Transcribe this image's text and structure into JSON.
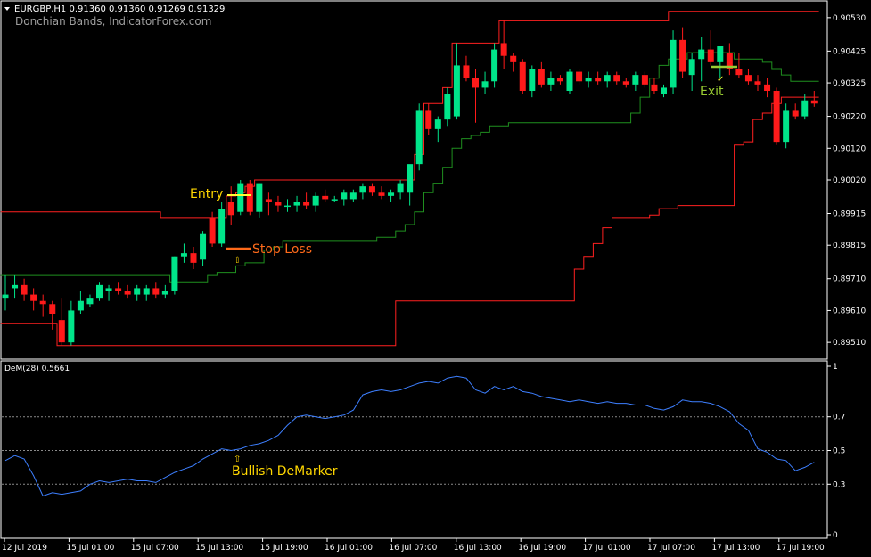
{
  "window": {
    "symbol_line": "EURGBP,H1  0.91360 0.91360 0.91269 0.91329",
    "indicator_name": "Donchian Bands, IndicatorForex.com",
    "sub_label": "DeM(28) 0.5661"
  },
  "annotations": {
    "entry": "Entry",
    "stop_loss": "Stop Loss",
    "exit": "Exit",
    "bullish": "Bullish DeMarker"
  },
  "colors": {
    "bull": "#00e58a",
    "bear": "#ff1a1a",
    "upper_band": "#ff2020",
    "middle_band": "#1f8f1f",
    "lower_band": "#ff2020",
    "demarker": "#3d7fff",
    "entry_line": "#ffff33",
    "stop_line": "#ff6a1a",
    "exit_line": "#9acd32",
    "annotation_text": "#ffd700",
    "axis": "#ffffff",
    "level_line": "#8a8a8a"
  },
  "chart_data": [
    {
      "type": "candlestick",
      "title": "EURGBP,H1",
      "y_ticks": [
        "0.90530",
        "0.90425",
        "0.90325",
        "0.90220",
        "0.90120",
        "0.90020",
        "0.89915",
        "0.89815",
        "0.89710",
        "0.89610",
        "0.89510"
      ],
      "ylim": [
        0.8946,
        0.9058
      ],
      "x_ticks": [
        "12 Jul 2019",
        "15 Jul 01:00",
        "15 Jul 07:00",
        "15 Jul 13:00",
        "15 Jul 19:00",
        "16 Jul 01:00",
        "16 Jul 07:00",
        "16 Jul 13:00",
        "16 Jul 19:00",
        "17 Jul 01:00",
        "17 Jul 07:00",
        "17 Jul 13:00",
        "17 Jul 19:00"
      ],
      "ohlc": [
        [
          0.8965,
          0.8972,
          0.8961,
          0.8966
        ],
        [
          0.8968,
          0.8972,
          0.8965,
          0.8969
        ],
        [
          0.8969,
          0.8971,
          0.8964,
          0.8966
        ],
        [
          0.8966,
          0.8968,
          0.8961,
          0.8964
        ],
        [
          0.8964,
          0.8966,
          0.8959,
          0.8963
        ],
        [
          0.8963,
          0.8964,
          0.8955,
          0.896
        ],
        [
          0.8958,
          0.8965,
          0.895,
          0.8951
        ],
        [
          0.8951,
          0.8964,
          0.895,
          0.8961
        ],
        [
          0.8961,
          0.8967,
          0.896,
          0.8964
        ],
        [
          0.8963,
          0.8966,
          0.8962,
          0.8965
        ],
        [
          0.8965,
          0.897,
          0.8964,
          0.8969
        ],
        [
          0.8967,
          0.8969,
          0.8964,
          0.8968
        ],
        [
          0.8968,
          0.897,
          0.8966,
          0.8967
        ],
        [
          0.8967,
          0.8969,
          0.8965,
          0.8966
        ],
        [
          0.8966,
          0.8969,
          0.8964,
          0.8968
        ],
        [
          0.8966,
          0.8969,
          0.8964,
          0.8968
        ],
        [
          0.8968,
          0.897,
          0.8965,
          0.8966
        ],
        [
          0.8966,
          0.8969,
          0.8965,
          0.8967
        ],
        [
          0.8967,
          0.8978,
          0.8966,
          0.8978
        ],
        [
          0.8978,
          0.8982,
          0.8976,
          0.8979
        ],
        [
          0.8979,
          0.8981,
          0.8974,
          0.8976
        ],
        [
          0.8977,
          0.8986,
          0.8975,
          0.8985
        ],
        [
          0.899,
          0.8992,
          0.8981,
          0.8982
        ],
        [
          0.8982,
          0.8995,
          0.8981,
          0.8993
        ],
        [
          0.8995,
          0.9,
          0.8988,
          0.8991
        ],
        [
          0.8992,
          0.9002,
          0.8991,
          0.9001
        ],
        [
          0.9001,
          0.9002,
          0.8991,
          0.8992
        ],
        [
          0.8992,
          0.9001,
          0.899,
          0.9001
        ],
        [
          0.8996,
          0.8998,
          0.8991,
          0.8995
        ],
        [
          0.8995,
          0.8997,
          0.8992,
          0.8994
        ],
        [
          0.8994,
          0.8996,
          0.8992,
          0.8994
        ],
        [
          0.8994,
          0.8997,
          0.8992,
          0.8995
        ],
        [
          0.8995,
          0.8998,
          0.8993,
          0.8994
        ],
        [
          0.8994,
          0.8998,
          0.8992,
          0.8997
        ],
        [
          0.8997,
          0.8999,
          0.8995,
          0.8996
        ],
        [
          0.8996,
          0.8997,
          0.8995,
          0.8996
        ],
        [
          0.8996,
          0.8999,
          0.8994,
          0.8998
        ],
        [
          0.8996,
          0.8999,
          0.8995,
          0.8998
        ],
        [
          0.8998,
          0.9001,
          0.8996,
          0.9
        ],
        [
          0.9,
          0.9001,
          0.8997,
          0.8998
        ],
        [
          0.8998,
          0.9,
          0.8996,
          0.8997
        ],
        [
          0.8997,
          0.8999,
          0.8995,
          0.8998
        ],
        [
          0.8998,
          0.9002,
          0.8996,
          0.9001
        ],
        [
          0.8998,
          0.9002,
          0.8994,
          0.9007
        ],
        [
          0.9007,
          0.9026,
          0.9005,
          0.9024
        ],
        [
          0.9024,
          0.9026,
          0.9016,
          0.9018
        ],
        [
          0.9018,
          0.9022,
          0.9014,
          0.9021
        ],
        [
          0.9021,
          0.9031,
          0.9019,
          0.9029
        ],
        [
          0.9022,
          0.9045,
          0.9021,
          0.9038
        ],
        [
          0.9038,
          0.9041,
          0.9033,
          0.9034
        ],
        [
          0.9034,
          0.9037,
          0.902,
          0.9031
        ],
        [
          0.9031,
          0.9036,
          0.9029,
          0.9033
        ],
        [
          0.9033,
          0.9045,
          0.9031,
          0.9043
        ],
        [
          0.9045,
          0.9052,
          0.9037,
          0.9041
        ],
        [
          0.9041,
          0.9042,
          0.9036,
          0.9039
        ],
        [
          0.9039,
          0.904,
          0.9029,
          0.903
        ],
        [
          0.903,
          0.9038,
          0.9028,
          0.9037
        ],
        [
          0.9037,
          0.9039,
          0.9031,
          0.9032
        ],
        [
          0.9032,
          0.9036,
          0.903,
          0.9034
        ],
        [
          0.9034,
          0.9035,
          0.9032,
          0.9033
        ],
        [
          0.903,
          0.9037,
          0.9029,
          0.9036
        ],
        [
          0.9036,
          0.9037,
          0.9032,
          0.9033
        ],
        [
          0.9033,
          0.9036,
          0.9031,
          0.9034
        ],
        [
          0.9034,
          0.9036,
          0.9032,
          0.9033
        ],
        [
          0.9033,
          0.9036,
          0.9031,
          0.9035
        ],
        [
          0.9035,
          0.9036,
          0.9032,
          0.9033
        ],
        [
          0.9033,
          0.9034,
          0.9031,
          0.9032
        ],
        [
          0.9032,
          0.9036,
          0.903,
          0.9035
        ],
        [
          0.9035,
          0.9036,
          0.9031,
          0.9032
        ],
        [
          0.9032,
          0.9034,
          0.9029,
          0.903
        ],
        [
          0.9029,
          0.9032,
          0.9028,
          0.9031
        ],
        [
          0.9031,
          0.9049,
          0.9029,
          0.9046
        ],
        [
          0.9046,
          0.905,
          0.9034,
          0.9036
        ],
        [
          0.9035,
          0.9042,
          0.903,
          0.904
        ],
        [
          0.904,
          0.9047,
          0.9033,
          0.9043
        ],
        [
          0.9043,
          0.9049,
          0.9038,
          0.9039
        ],
        [
          0.9039,
          0.9043,
          0.9034,
          0.9044
        ],
        [
          0.9042,
          0.9045,
          0.9035,
          0.9037
        ],
        [
          0.9037,
          0.9042,
          0.9034,
          0.9035
        ],
        [
          0.9035,
          0.9037,
          0.9032,
          0.9033
        ],
        [
          0.9033,
          0.9035,
          0.903,
          0.9032
        ],
        [
          0.9032,
          0.9034,
          0.9028,
          0.903
        ],
        [
          0.903,
          0.9031,
          0.9013,
          0.9014
        ],
        [
          0.9014,
          0.9026,
          0.9012,
          0.9024
        ],
        [
          0.9024,
          0.9026,
          0.9021,
          0.9022
        ],
        [
          0.9022,
          0.9029,
          0.9021,
          0.9027
        ],
        [
          0.9027,
          0.903,
          0.9025,
          0.9026
        ]
      ],
      "bands": {
        "upper": [
          0.8992,
          0.8992,
          0.8992,
          0.8992,
          0.8992,
          0.8992,
          0.8992,
          0.8992,
          0.8992,
          0.8992,
          0.8992,
          0.8992,
          0.8992,
          0.8992,
          0.8992,
          0.8992,
          0.8992,
          0.899,
          0.899,
          0.899,
          0.899,
          0.899,
          0.899,
          0.899,
          0.8997,
          0.8998,
          0.9,
          0.9002,
          0.9002,
          0.9002,
          0.9002,
          0.9002,
          0.9002,
          0.9002,
          0.9002,
          0.9002,
          0.9002,
          0.9002,
          0.9002,
          0.9002,
          0.9002,
          0.9002,
          0.9002,
          0.9002,
          0.901,
          0.9026,
          0.9026,
          0.9031,
          0.9045,
          0.9045,
          0.9045,
          0.9045,
          0.9045,
          0.9052,
          0.9052,
          0.9052,
          0.9052,
          0.9052,
          0.9052,
          0.9052,
          0.9052,
          0.9052,
          0.9052,
          0.9052,
          0.9052,
          0.9052,
          0.9052,
          0.9052,
          0.9052,
          0.9052,
          0.9052,
          0.9055,
          0.9055,
          0.9055,
          0.9055,
          0.9055,
          0.9055,
          0.9055,
          0.9055,
          0.9055,
          0.9055,
          0.9055,
          0.9055,
          0.9055,
          0.9055,
          0.9055,
          0.9055
        ],
        "middle": [
          0.8972,
          0.8972,
          0.8972,
          0.8972,
          0.8972,
          0.8972,
          0.8972,
          0.8972,
          0.8972,
          0.8972,
          0.8972,
          0.8972,
          0.8972,
          0.8972,
          0.8972,
          0.8972,
          0.8972,
          0.8972,
          0.897,
          0.897,
          0.897,
          0.897,
          0.8972,
          0.8973,
          0.8973,
          0.8975,
          0.8976,
          0.8976,
          0.898,
          0.8981,
          0.8983,
          0.8983,
          0.8983,
          0.8983,
          0.8983,
          0.8983,
          0.8983,
          0.8983,
          0.8983,
          0.8983,
          0.8984,
          0.8984,
          0.8986,
          0.8988,
          0.8992,
          0.8998,
          0.9001,
          0.9006,
          0.9012,
          0.9015,
          0.9016,
          0.9017,
          0.9019,
          0.9019,
          0.902,
          0.902,
          0.902,
          0.902,
          0.902,
          0.902,
          0.902,
          0.902,
          0.902,
          0.902,
          0.902,
          0.902,
          0.902,
          0.9023,
          0.9028,
          0.9034,
          0.9038,
          0.904,
          0.904,
          0.9042,
          0.9042,
          0.9042,
          0.9042,
          0.9042,
          0.904,
          0.904,
          0.904,
          0.9039,
          0.9037,
          0.9035,
          0.9033,
          0.9033,
          0.9033
        ],
        "lower": [
          0.8957,
          0.8957,
          0.8957,
          0.8957,
          0.8957,
          0.8957,
          0.895,
          0.895,
          0.895,
          0.895,
          0.895,
          0.895,
          0.895,
          0.895,
          0.895,
          0.895,
          0.895,
          0.895,
          0.895,
          0.895,
          0.895,
          0.895,
          0.895,
          0.895,
          0.895,
          0.895,
          0.895,
          0.895,
          0.895,
          0.895,
          0.895,
          0.895,
          0.895,
          0.895,
          0.895,
          0.895,
          0.895,
          0.895,
          0.895,
          0.895,
          0.895,
          0.895,
          0.8964,
          0.8964,
          0.8964,
          0.8964,
          0.8964,
          0.8964,
          0.8964,
          0.8964,
          0.8964,
          0.8964,
          0.8964,
          0.8964,
          0.8964,
          0.8964,
          0.8964,
          0.8964,
          0.8964,
          0.8964,
          0.8964,
          0.8974,
          0.8978,
          0.8982,
          0.8987,
          0.899,
          0.899,
          0.899,
          0.899,
          0.8991,
          0.8993,
          0.8993,
          0.8994,
          0.8994,
          0.8994,
          0.8994,
          0.8994,
          0.8994,
          0.9013,
          0.9014,
          0.9021,
          0.9023,
          0.9026,
          0.9028,
          0.9028,
          0.9028,
          0.9028
        ]
      }
    },
    {
      "type": "line",
      "title": "DeM(28) 0.5661",
      "y_ticks": [
        "1",
        "0.7",
        "0.5",
        "0.3",
        "0"
      ],
      "levels": [
        0.7,
        0.5,
        0.3
      ],
      "ylim": [
        0,
        1
      ],
      "series": [
        {
          "name": "DeM(28)",
          "values": [
            0.44,
            0.47,
            0.45,
            0.35,
            0.23,
            0.25,
            0.24,
            0.25,
            0.26,
            0.3,
            0.32,
            0.31,
            0.32,
            0.33,
            0.32,
            0.32,
            0.31,
            0.34,
            0.37,
            0.39,
            0.41,
            0.45,
            0.48,
            0.51,
            0.5,
            0.51,
            0.53,
            0.54,
            0.56,
            0.59,
            0.65,
            0.7,
            0.71,
            0.7,
            0.69,
            0.7,
            0.71,
            0.74,
            0.83,
            0.85,
            0.86,
            0.85,
            0.86,
            0.88,
            0.9,
            0.91,
            0.9,
            0.93,
            0.94,
            0.93,
            0.86,
            0.84,
            0.88,
            0.86,
            0.88,
            0.85,
            0.84,
            0.82,
            0.81,
            0.8,
            0.79,
            0.8,
            0.79,
            0.78,
            0.79,
            0.78,
            0.78,
            0.77,
            0.77,
            0.75,
            0.74,
            0.76,
            0.8,
            0.79,
            0.79,
            0.78,
            0.76,
            0.73,
            0.66,
            0.62,
            0.51,
            0.49,
            0.45,
            0.44,
            0.38,
            0.4,
            0.43
          ]
        }
      ]
    }
  ]
}
